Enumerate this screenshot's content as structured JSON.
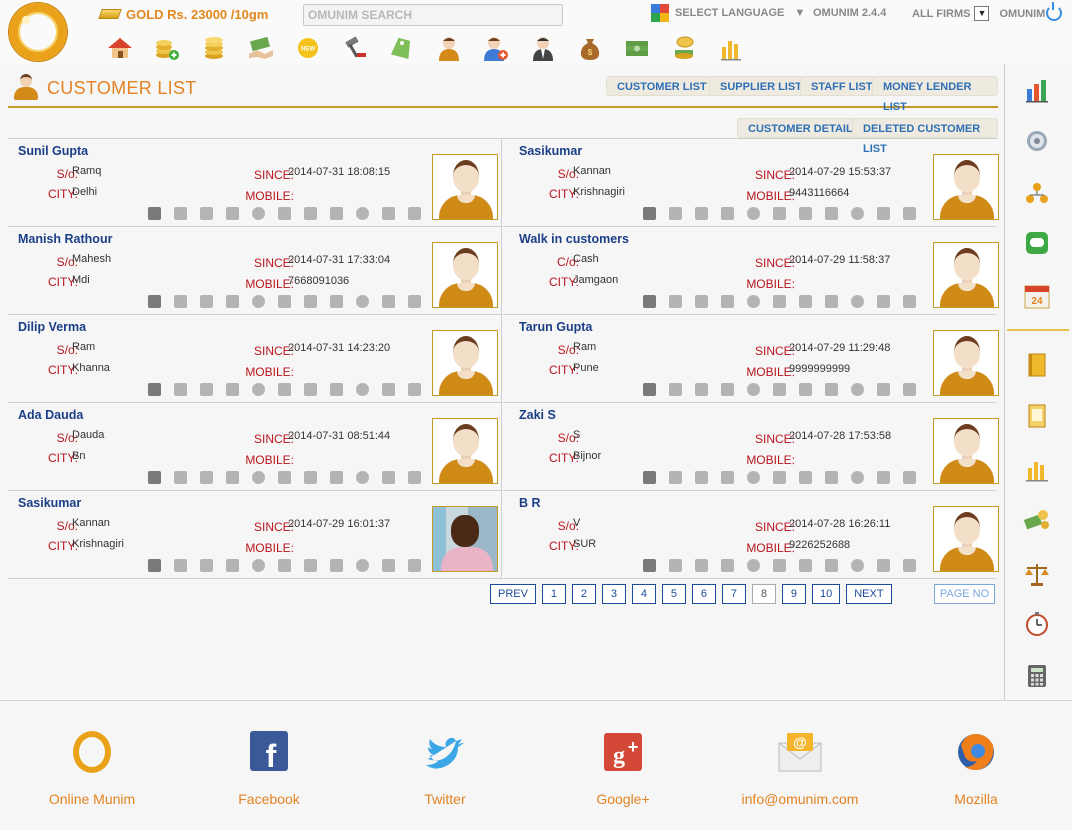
{
  "header": {
    "gold_price": "GOLD Rs. 23000 /10gm",
    "search_placeholder": "OMUNIM SEARCH",
    "select_language": "SELECT LANGUAGE",
    "version": "OMUNIM 2.4.4",
    "firms": "ALL FIRMS",
    "user": "OMUNIM",
    "nav_icons": [
      "home-icon",
      "add-gold-loan-icon",
      "gold-coins-icon",
      "money-handshake-icon",
      "new-badge-icon",
      "auction-hammer-icon",
      "price-tag-icon",
      "customer-icon",
      "add-customer-icon",
      "staff-icon",
      "money-bag-icon",
      "cash-icon",
      "coin-stack-icon",
      "reports-chart-icon"
    ]
  },
  "page": {
    "title": "CUSTOMER LIST",
    "tabs": [
      "CUSTOMER LIST",
      "SUPPLIER LIST",
      "STAFF LIST",
      "MONEY LENDER LIST"
    ],
    "subtabs": [
      "CUSTOMER DETAIL",
      "DELETED CUSTOMER LIST"
    ]
  },
  "labels": {
    "since": "SINCE:",
    "mobile": "MOBILE:",
    "city": "CITY:"
  },
  "customers": [
    {
      "name": "Sunil Gupta",
      "rel": "S/o:",
      "relname": "Ramq",
      "city": "Delhi",
      "since": "2014-07-31 18:08:15",
      "mobile": ""
    },
    {
      "name": "Sasikumar",
      "rel": "S/o:",
      "relname": "Kannan",
      "city": "Krishnagiri",
      "since": "2014-07-29 15:53:37",
      "mobile": "9443116664"
    },
    {
      "name": "Manish Rathour",
      "rel": "S/o:",
      "relname": "Mahesh",
      "city": "Mdi",
      "since": "2014-07-31 17:33:04",
      "mobile": "7668091036"
    },
    {
      "name": "Walk in customers",
      "rel": "C/o:",
      "relname": "Cash",
      "city": "Jamgaon",
      "since": "2014-07-29 11:58:37",
      "mobile": ""
    },
    {
      "name": "Dilip Verma",
      "rel": "S/o:",
      "relname": "Ram",
      "city": "Khanna",
      "since": "2014-07-31 14:23:20",
      "mobile": ""
    },
    {
      "name": "Tarun Gupta",
      "rel": "S/o:",
      "relname": "Ram",
      "city": "Pune",
      "since": "2014-07-29 11:29:48",
      "mobile": "9999999999"
    },
    {
      "name": "Ada Dauda",
      "rel": "S/o:",
      "relname": "Dauda",
      "city": "Bn",
      "since": "2014-07-31 08:51:44",
      "mobile": ""
    },
    {
      "name": "Zaki S",
      "rel": "S/o:",
      "relname": "S",
      "city": "Bijnor",
      "since": "2014-07-28 17:53:58",
      "mobile": ""
    },
    {
      "name": "Sasikumar",
      "rel": "S/o:",
      "relname": "Kannan",
      "city": "Krishnagiri",
      "since": "2014-07-29 16:01:37",
      "mobile": ""
    },
    {
      "name": "B R",
      "rel": "S/o:",
      "relname": "V",
      "city": "SUR",
      "since": "2014-07-28 16:26:11",
      "mobile": "9226252688"
    }
  ],
  "pagination": {
    "prev": "PREV",
    "pages": [
      "1",
      "2",
      "3",
      "4",
      "5",
      "6",
      "7",
      "8",
      "9",
      "10"
    ],
    "current": "8",
    "next": "NEXT",
    "page_no": "PAGE NO"
  },
  "sidebar_icons": [
    "bar-chart-icon",
    "settings-gear-icon",
    "hierarchy-icon",
    "sms-icon",
    "calendar-icon",
    "ledger-icon",
    "notebook-icon",
    "statistics-icon",
    "money-exchange-icon",
    "balance-scale-icon",
    "stopwatch-icon",
    "calculator-icon"
  ],
  "footer": [
    {
      "label": "Online Munim",
      "icon": "omunim-logo-icon"
    },
    {
      "label": "Facebook",
      "icon": "facebook-icon"
    },
    {
      "label": "Twitter",
      "icon": "twitter-icon"
    },
    {
      "label": "Google+",
      "icon": "google-plus-icon"
    },
    {
      "label": "info@omunim.com",
      "icon": "email-icon"
    },
    {
      "label": "Mozilla",
      "icon": "firefox-icon"
    }
  ],
  "colors": {
    "accent": "#e48323",
    "name_blue": "#1b3f86",
    "label_red": "#b8161c",
    "link_blue": "#2f6fb5",
    "gold": "#c59a29"
  }
}
